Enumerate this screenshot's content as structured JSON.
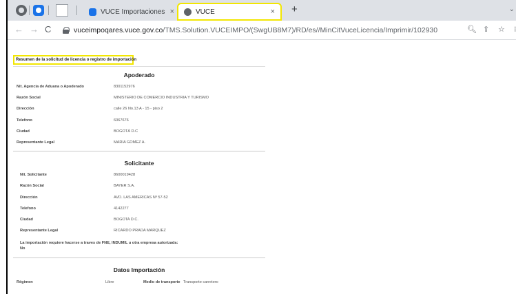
{
  "browser": {
    "tabs": [
      {
        "title": "VUCE Importaciones",
        "close": "×"
      },
      {
        "title": "VUCE",
        "close": "×"
      }
    ],
    "new_tab": "+",
    "tab_menu": "⌄",
    "nav": {
      "back": "←",
      "forward": "→",
      "reload": "C"
    },
    "address": {
      "host": "vuceimpoqares.vuce.gov.co",
      "path": "/TMS.Solution.VUCEIMPO/(SwgUB8M7)/RD/es//MinCitVuceLicencia/Imprimir/102930"
    },
    "toolbar_icons": {
      "zoom": "🔍︎",
      "share": "⇪",
      "star": "☆",
      "more": "⁝"
    }
  },
  "document": {
    "header": "Resumen de la solicitud de licencia o registro de importación",
    "apoderado": {
      "title": "Apoderado",
      "rows": [
        {
          "label": "Nit. Agencia de Aduana o Apoderado",
          "value": "8301152976"
        },
        {
          "label": "Razón Social",
          "value": "MINISTERIO DE COMERCIO INDUSTRIA Y TURISMO"
        },
        {
          "label": "Dirección",
          "value": "calle 26 No.13 A - 15 - piso 2"
        },
        {
          "label": "Telefono",
          "value": "6067676"
        },
        {
          "label": "Ciudad",
          "value": "BOGOTÁ D.C"
        },
        {
          "label": "Representante Legal",
          "value": "MARIA GOMEZ A."
        }
      ]
    },
    "solicitante": {
      "title": "Solicitante",
      "rows": [
        {
          "label": "Nit. Solicitante",
          "value": "8600019428"
        },
        {
          "label": "Razón Social",
          "value": "BAYER S.A."
        },
        {
          "label": "Dirección",
          "value": "AVD. LAS AMERICAS Nº 57-52"
        },
        {
          "label": "Telefono",
          "value": "4142277"
        },
        {
          "label": "Ciudad",
          "value": "BOGOTA D.C."
        },
        {
          "label": "Representante Legal",
          "value": "RICARDO PRADA MARQUEZ"
        }
      ],
      "note": "La importación requiere hacerse a traves de FNE, INDUMIL u otra empresa autorizada:",
      "note_value": "No"
    },
    "datos": {
      "title": "Datos Importación",
      "regimen_label": "Régimen",
      "regimen_value": "Libre",
      "transporte_label": "Medio de transporte",
      "transporte_value": "Transporte carretero"
    }
  }
}
